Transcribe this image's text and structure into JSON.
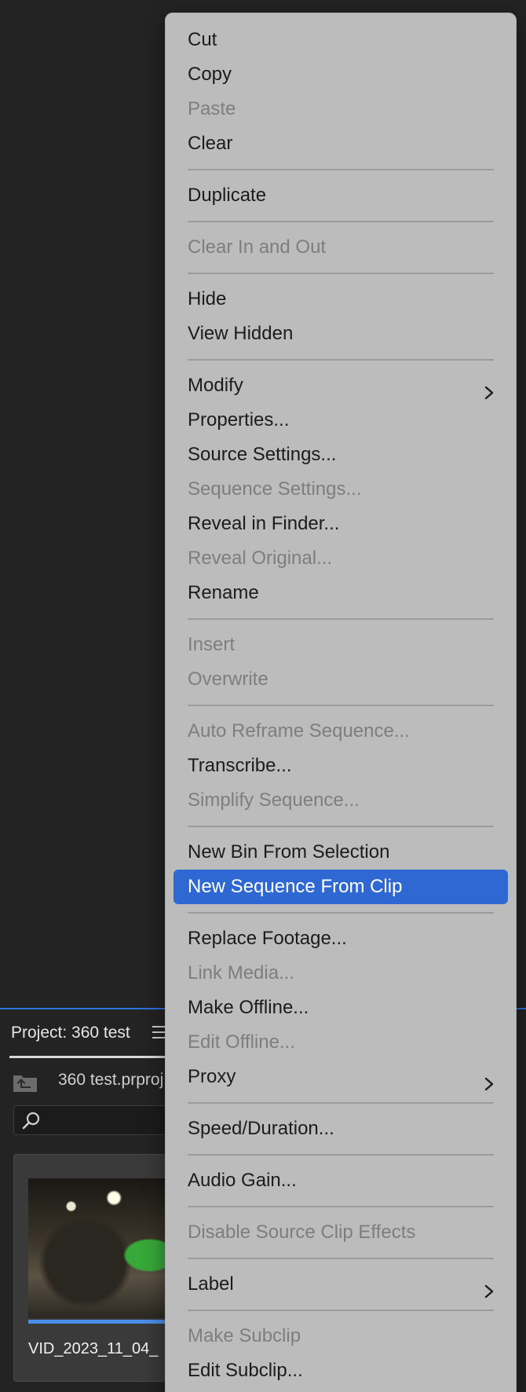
{
  "project_panel": {
    "title": "Project: 360 test",
    "path": "360 test.prproj",
    "clip_name": "VID_2023_11_04_"
  },
  "context_menu": {
    "groups": [
      [
        {
          "label": "Cut",
          "enabled": true
        },
        {
          "label": "Copy",
          "enabled": true
        },
        {
          "label": "Paste",
          "enabled": false
        },
        {
          "label": "Clear",
          "enabled": true
        }
      ],
      [
        {
          "label": "Duplicate",
          "enabled": true
        }
      ],
      [
        {
          "label": "Clear In and Out",
          "enabled": false
        }
      ],
      [
        {
          "label": "Hide",
          "enabled": true
        },
        {
          "label": "View Hidden",
          "enabled": true
        }
      ],
      [
        {
          "label": "Modify",
          "enabled": true,
          "submenu": true
        },
        {
          "label": "Properties...",
          "enabled": true
        },
        {
          "label": "Source Settings...",
          "enabled": true
        },
        {
          "label": "Sequence Settings...",
          "enabled": false
        },
        {
          "label": "Reveal in Finder...",
          "enabled": true
        },
        {
          "label": "Reveal Original...",
          "enabled": false
        },
        {
          "label": "Rename",
          "enabled": true
        }
      ],
      [
        {
          "label": "Insert",
          "enabled": false
        },
        {
          "label": "Overwrite",
          "enabled": false
        }
      ],
      [
        {
          "label": "Auto Reframe Sequence...",
          "enabled": false
        },
        {
          "label": "Transcribe...",
          "enabled": true
        },
        {
          "label": "Simplify Sequence...",
          "enabled": false
        }
      ],
      [
        {
          "label": "New Bin From Selection",
          "enabled": true
        },
        {
          "label": "New Sequence From Clip",
          "enabled": true,
          "selected": true
        }
      ],
      [
        {
          "label": "Replace Footage...",
          "enabled": true
        },
        {
          "label": "Link Media...",
          "enabled": false
        },
        {
          "label": "Make Offline...",
          "enabled": true
        },
        {
          "label": "Edit Offline...",
          "enabled": false
        },
        {
          "label": "Proxy",
          "enabled": true,
          "submenu": true
        }
      ],
      [
        {
          "label": "Speed/Duration...",
          "enabled": true
        }
      ],
      [
        {
          "label": "Audio Gain...",
          "enabled": true
        }
      ],
      [
        {
          "label": "Disable Source Clip Effects",
          "enabled": false
        }
      ],
      [
        {
          "label": "Label",
          "enabled": true,
          "submenu": true
        }
      ],
      [
        {
          "label": "Make Subclip",
          "enabled": false
        },
        {
          "label": "Edit Subclip...",
          "enabled": true
        }
      ]
    ]
  },
  "colors": {
    "selection": "#2f68d3",
    "panel_accent": "#2d6fdb"
  }
}
